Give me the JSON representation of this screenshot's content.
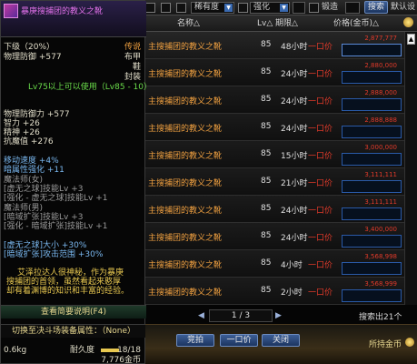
{
  "topbar": {
    "rarity_label": "稀有度",
    "rarity_value": "",
    "enhance_label": "强化",
    "forge_label": "锻造",
    "search_label": "搜索",
    "default_label": "默认设"
  },
  "table": {
    "headers": {
      "name": "名称△",
      "lv": "Lv△",
      "time": "期限△",
      "price": "价格(金币)△"
    },
    "rows": [
      {
        "name": "主搜捕团的教义之靴",
        "lv": "85",
        "time": "48小时",
        "bid": "一口价",
        "price": "2,877,777"
      },
      {
        "name": "主搜捕团的教义之靴",
        "lv": "85",
        "time": "24小时",
        "bid": "一口价",
        "price": "2,880,000"
      },
      {
        "name": "主搜捕团的教义之靴",
        "lv": "85",
        "time": "24小时",
        "bid": "一口价",
        "price": "2,888,000"
      },
      {
        "name": "主搜捕团的教义之靴",
        "lv": "85",
        "time": "24小时",
        "bid": "一口价",
        "price": "2,888,888"
      },
      {
        "name": "主搜捕团的教义之靴",
        "lv": "85",
        "time": "15小时",
        "bid": "一口价",
        "price": "3,000,000"
      },
      {
        "name": "主搜捕团的教义之靴",
        "lv": "85",
        "time": "21小时",
        "bid": "一口价",
        "price": "3,111,111"
      },
      {
        "name": "主搜捕团的教义之靴",
        "lv": "85",
        "time": "24小时",
        "bid": "一口价",
        "price": "3,111,111"
      },
      {
        "name": "主搜捕团的教义之靴",
        "lv": "85",
        "time": "24小时",
        "bid": "一口价",
        "price": "3,400,000"
      },
      {
        "name": "主搜捕团的教义之靴",
        "lv": "85",
        "time": "4小时",
        "bid": "一口价",
        "price": "3,568,998"
      },
      {
        "name": "主搜捕团的教义之靴",
        "lv": "85",
        "time": "2小时",
        "bid": "一口价",
        "price": "3,568,999"
      }
    ]
  },
  "tooltip": {
    "title": "暴庚搜捕团的教义之靴",
    "grade": "下级（20%）",
    "legend_tag": "传说",
    "type1": "布甲",
    "type2": "鞋",
    "type3": "封装",
    "def": "物理防御 +577",
    "req": "Lv75以上可以使用（Lv85 - 10）",
    "stat1": "物理防御力 +577",
    "stat2": "智力 +26",
    "stat3": "精神 +26",
    "stat4": "抗魔值 +276",
    "eff1": "移动速度 +4%",
    "eff2": "暗属性强化 +11",
    "skill_head1": "魔法师(女)",
    "skill1": "[虚无之球]技能Lv +3",
    "skill2": "[强化 - 虚无之球]技能Lv +1",
    "skill_head2": "魔法师(男)",
    "skill3": "[暗域扩张]技能Lv +3",
    "skill4": "[强化 - 暗域扩张]技能Lv +1",
    "skill5": "[虚无之球]大小 +30%",
    "skill6": "[暗域扩张]攻击范围 +30%",
    "flavor1": "艾泽拉达人很神秘，作为暴庚",
    "flavor2": "搜捕团的首领，虽然看起来憨厚",
    "flavor3": "却有着渊博的知识和丰富的经验。",
    "btn_view": "查看简要说明(F4)",
    "set_line": "切换至决斗场装备属性：（None）",
    "weight": "0.6kg",
    "durability_label": "耐久度",
    "durability_value": "18/18",
    "durability_fraction": 1.0,
    "sell_price": "7,776金币"
  },
  "bottom": {
    "page": "1 / 3",
    "results": "搜索出21个",
    "bid_btn": "竞拍",
    "buyout_btn": "一口价",
    "close_btn": "关闭",
    "gold_label": "所持金币"
  }
}
